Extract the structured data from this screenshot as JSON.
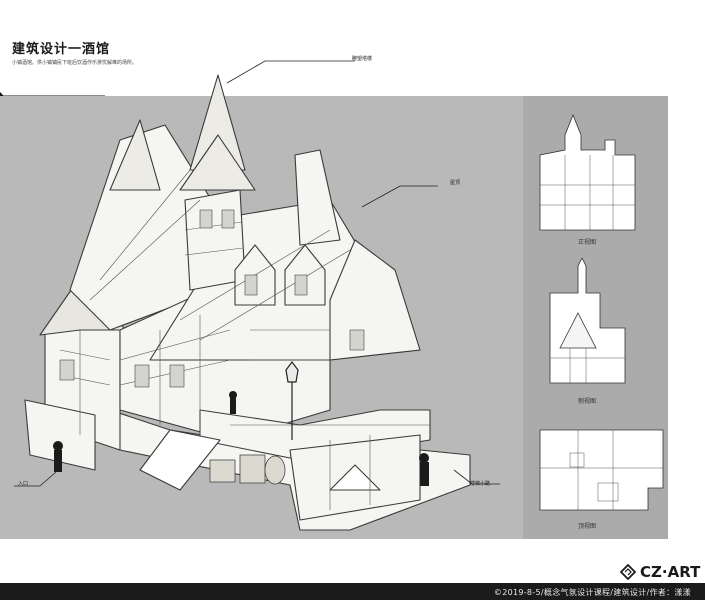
{
  "header": {
    "title": "建筑设计一酒馆",
    "description": "小镇酒馆。供小镇镇民下班后饮酒作乐排忧解难的场所。"
  },
  "annotations": {
    "lookout": "瞭望塔楼",
    "roof": "屋顶",
    "entrance": "入口",
    "back_stairs": "楼梯小路"
  },
  "views": {
    "front": "正视图",
    "side": "侧视图",
    "top": "顶视图"
  },
  "footer": {
    "credit": "©2019-8-5/概念气氛设计课程/建筑设计/作者：漾漾",
    "logo": "CZ·ART"
  }
}
